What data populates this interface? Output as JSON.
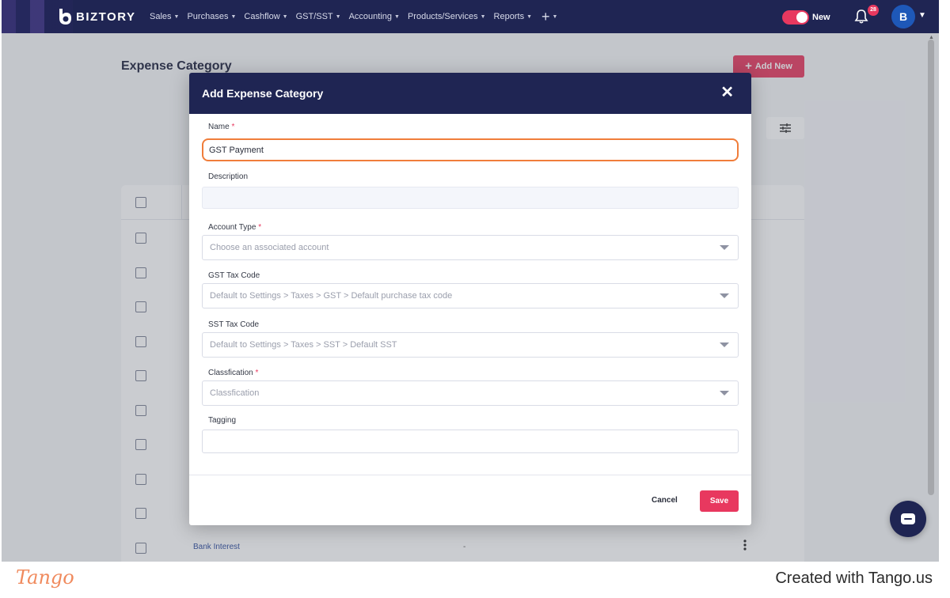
{
  "topnav": {
    "brand": "BIZTORY",
    "items": [
      {
        "label": "Sales"
      },
      {
        "label": "Purchases"
      },
      {
        "label": "Cashflow"
      },
      {
        "label": "GST/SST"
      },
      {
        "label": "Accounting"
      },
      {
        "label": "Products/Services"
      },
      {
        "label": "Reports"
      }
    ],
    "plus_icon": "plus-icon",
    "toggle_label": "New",
    "notification_count": "28",
    "avatar_initial": "B",
    "accent_color": "#e8385f",
    "nav_bg_color": "#1f2553"
  },
  "page": {
    "title": "Expense Category",
    "add_new_label": "Add New",
    "rows": [
      {
        "name": "Bank Interest",
        "value": "-"
      }
    ]
  },
  "modal": {
    "title": "Add Expense Category",
    "fields": {
      "name": {
        "label": "Name",
        "required": "*",
        "value": "GST Payment"
      },
      "description": {
        "label": "Description",
        "value": ""
      },
      "account_type": {
        "label": "Account Type",
        "required": "*",
        "placeholder": "Choose an associated account"
      },
      "gst_tax_code": {
        "label": "GST Tax Code",
        "placeholder": "Default to Settings > Taxes > GST > Default purchase tax code"
      },
      "sst_tax_code": {
        "label": "SST Tax Code",
        "placeholder": "Default to Settings > Taxes > SST > Default SST"
      },
      "classification": {
        "label": "Classfication",
        "required": "*",
        "placeholder": "Classfication"
      },
      "tagging": {
        "label": "Tagging",
        "value": ""
      }
    },
    "cancel_label": "Cancel",
    "save_label": "Save"
  },
  "watermark": {
    "logo": "Tango",
    "credit": "Created with Tango.us"
  }
}
